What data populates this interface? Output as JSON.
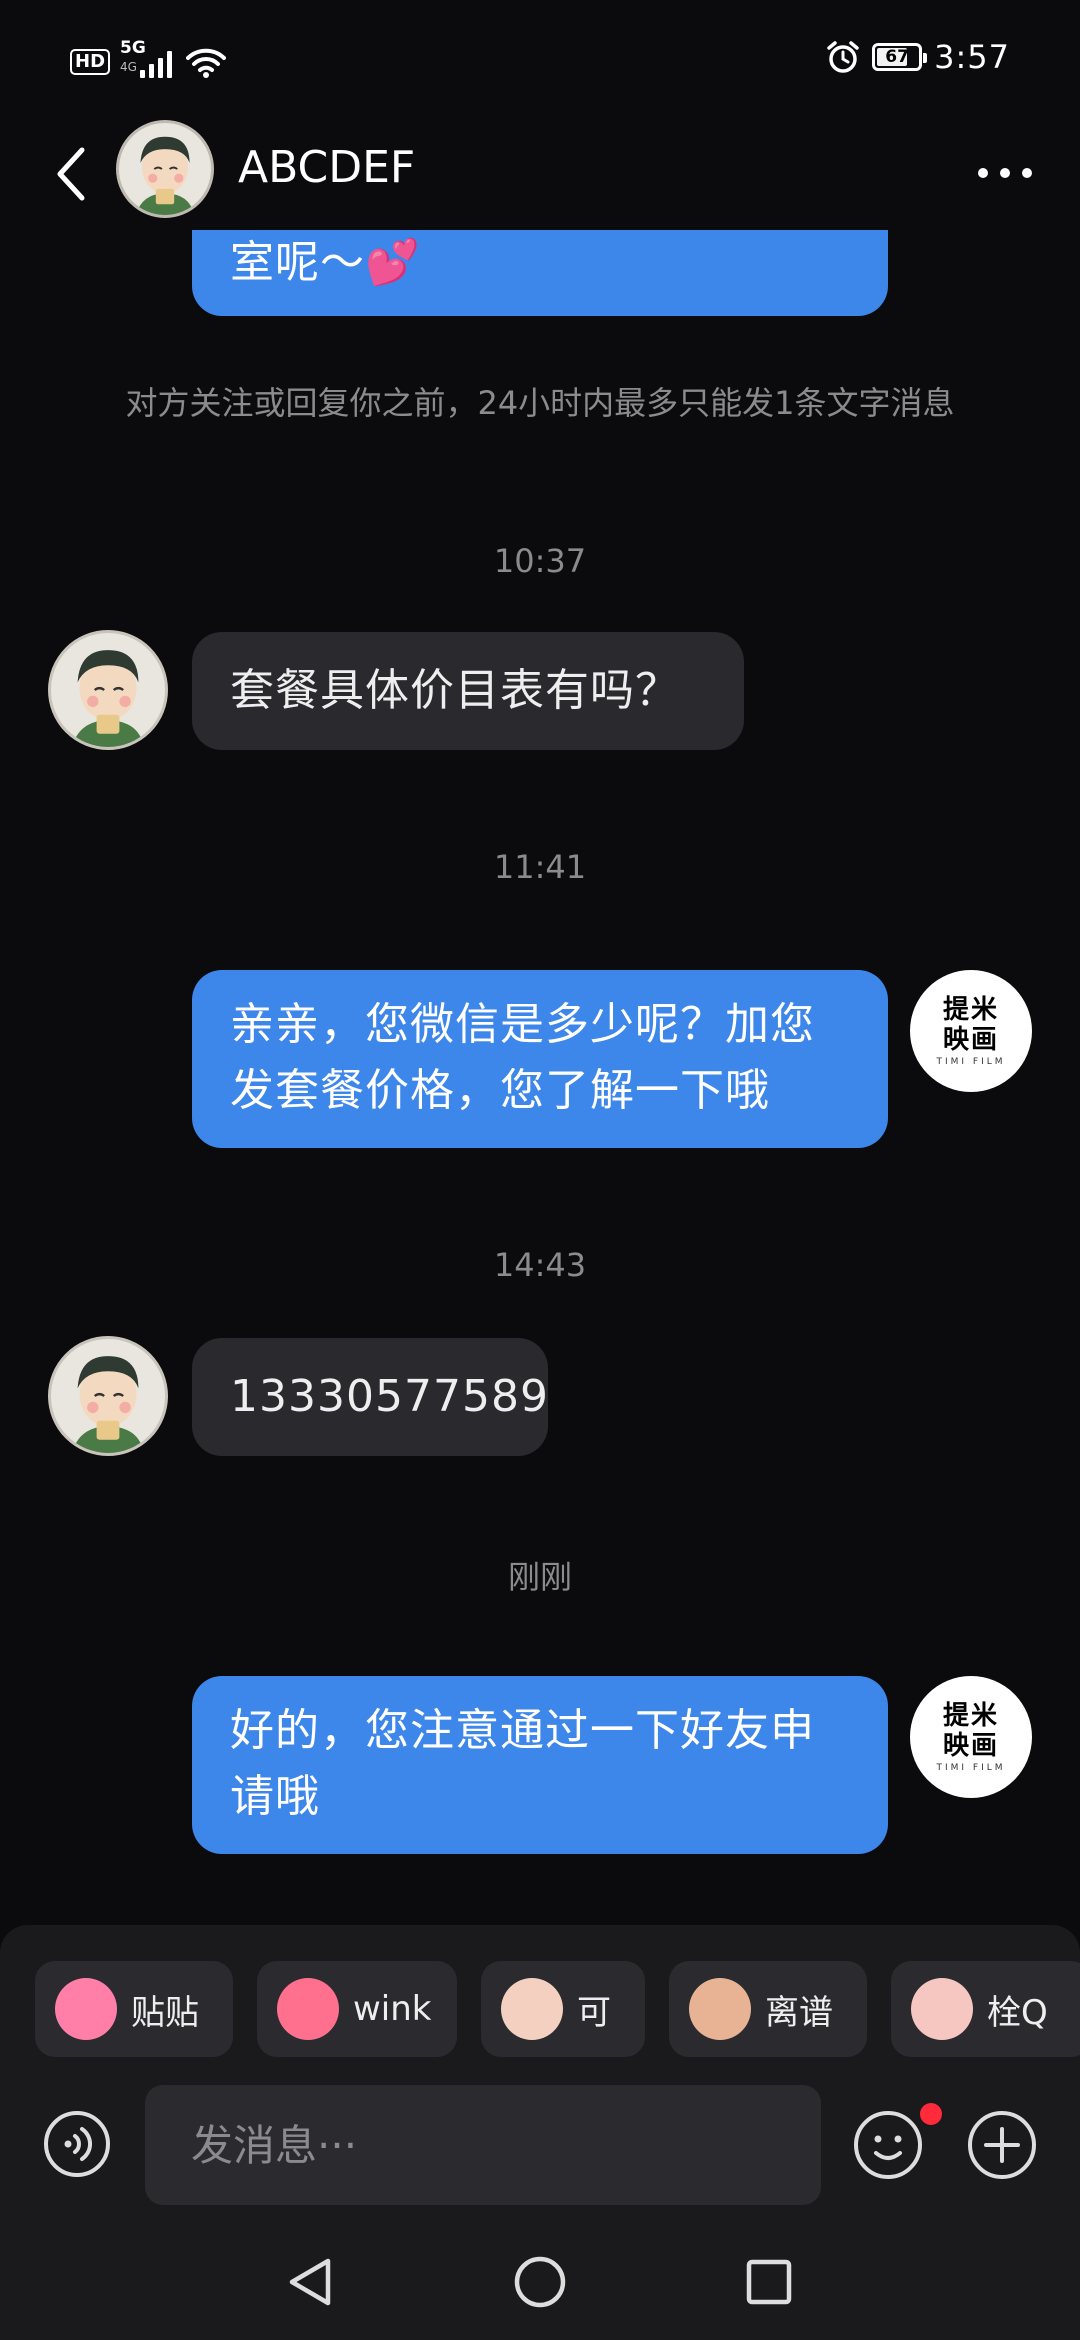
{
  "status_bar": {
    "hd": "HD",
    "network": "5G",
    "network_sub": "4G",
    "battery": "67",
    "time": "3:57"
  },
  "header": {
    "contact_name": "ABCDEF"
  },
  "messages": {
    "partial_out": "室呢～💕",
    "system_notice": "对方关注或回复你之前，24小时内最多只能发1条文字消息",
    "ts1": "10:37",
    "in1": "套餐具体价目表有吗？",
    "ts2": "11:41",
    "out1": "亲亲，您微信是多少呢？加您发套餐价格，您了解一下哦",
    "ts3": "14:43",
    "in2": "13330577589",
    "ts4": "刚刚",
    "out2": "好的，您注意通过一下好友申请哦"
  },
  "logo_avatar": {
    "line1": "提米",
    "line2": "映画",
    "line3": "TIMI FILM"
  },
  "stickers": [
    {
      "label": "贴贴",
      "color": "#ff7fa8"
    },
    {
      "label": "wink",
      "color": "#ff6f8e"
    },
    {
      "label": "可",
      "color": "#f3d0c0"
    },
    {
      "label": "离谱",
      "color": "#e8b394"
    },
    {
      "label": "栓Q",
      "color": "#f6c6c0"
    }
  ],
  "input": {
    "placeholder": "发消息···"
  },
  "colors": {
    "outgoing_bubble": "#3d86ea",
    "incoming_bubble": "#2a2a2e",
    "background": "#0b0b0d",
    "notification_dot": "#ff2a3a"
  }
}
